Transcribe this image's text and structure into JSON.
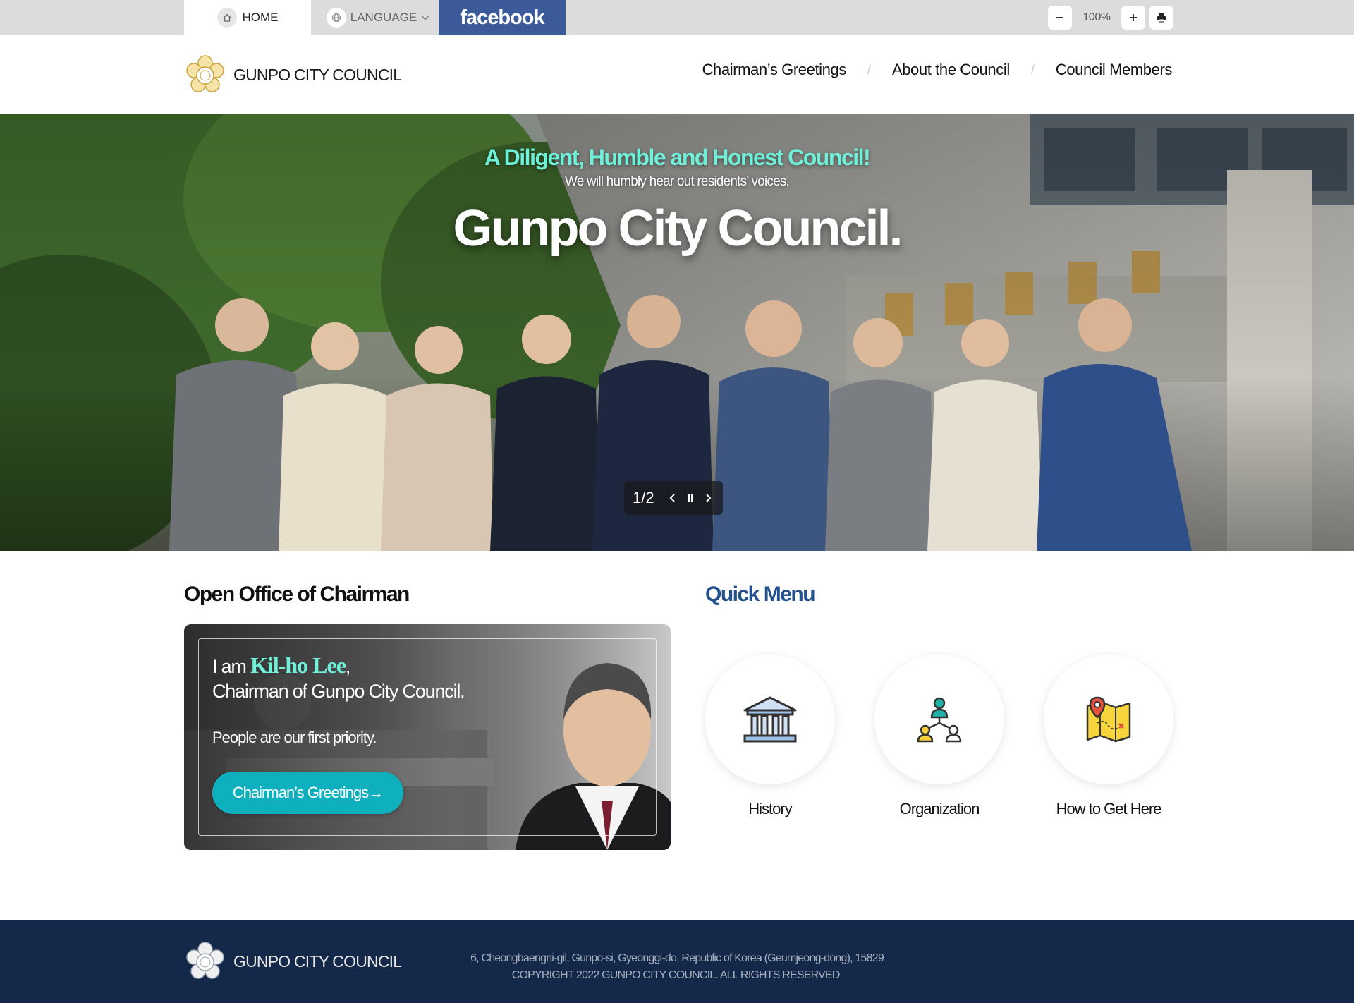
{
  "utility": {
    "home_label": "HOME",
    "language_label": "LANGUAGE",
    "facebook_label": "facebook",
    "zoom_value": "100%"
  },
  "header": {
    "brand": "GUNPO CITY COUNCIL",
    "nav": [
      "Chairman’s Greetings",
      "About the Council",
      "Council Members"
    ],
    "nav_separator": "/"
  },
  "hero": {
    "slogan": "A Diligent, Humble and Honest Council!",
    "subtitle": "We will humbly hear out residents’ voices.",
    "title": "Gunpo City Council.",
    "slide_counter": "1/2"
  },
  "office": {
    "section_title": "Open Office of Chairman",
    "intro_prefix": "I am",
    "chairman_name": "Kil-ho Lee",
    "intro_suffix": ",",
    "line2": "Chairman of Gunpo City Council.",
    "motto": "People are our first priority.",
    "button_label": "Chairman’s Greetings→"
  },
  "quick_menu": {
    "section_title": "Quick Menu",
    "items": [
      {
        "label": "History",
        "icon": "building-icon"
      },
      {
        "label": "Organization",
        "icon": "org-chart-icon"
      },
      {
        "label": "How to Get Here",
        "icon": "map-pin-icon"
      }
    ]
  },
  "footer": {
    "brand": "GUNPO CITY COUNCIL",
    "address": "6, Cheongbaengni-gil, Gunpo-si, Gyeonggi-do, Republic of Korea (Geumjeong-dong), 15829",
    "copyright": "COPYRIGHT 2022 GUNPO CITY COUNCIL. ALL RIGHTS RESERVED."
  },
  "colors": {
    "accent_teal": "#0fb0bd",
    "slogan_mint": "#6ff1d9",
    "quick_title_blue": "#24508e",
    "footer_navy": "#14284a",
    "facebook_blue": "#3c5a99"
  }
}
